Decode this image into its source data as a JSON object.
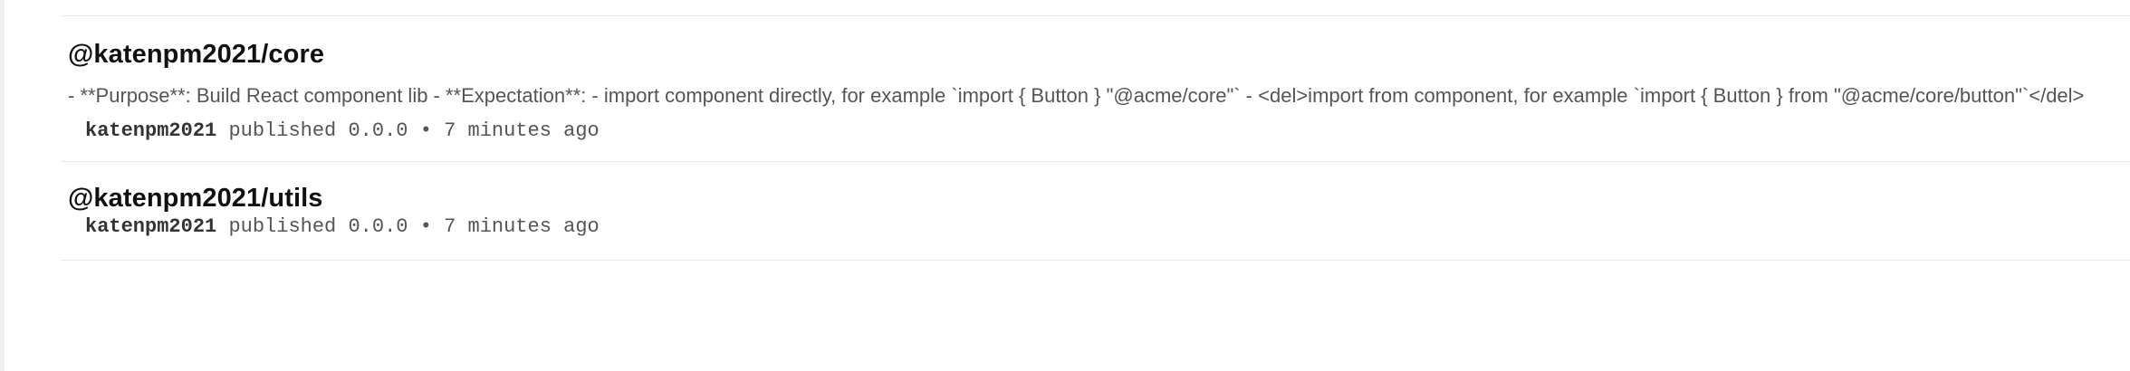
{
  "packages": [
    {
      "name": "@katenpm2021/core",
      "description": "- **Purpose**: Build React component lib - **Expectation**: - import component directly, for example `import { Button } \"@acme/core\"` - <del>import from component, for example `import { Button } from \"@acme/core/button\"`</del>",
      "publisher": "katenpm2021",
      "action": "published",
      "version": "0.0.0",
      "separator": "•",
      "time": "7 minutes ago"
    },
    {
      "name": "@katenpm2021/utils",
      "publisher": "katenpm2021",
      "action": "published",
      "version": "0.0.0",
      "separator": "•",
      "time": "7 minutes ago"
    }
  ]
}
